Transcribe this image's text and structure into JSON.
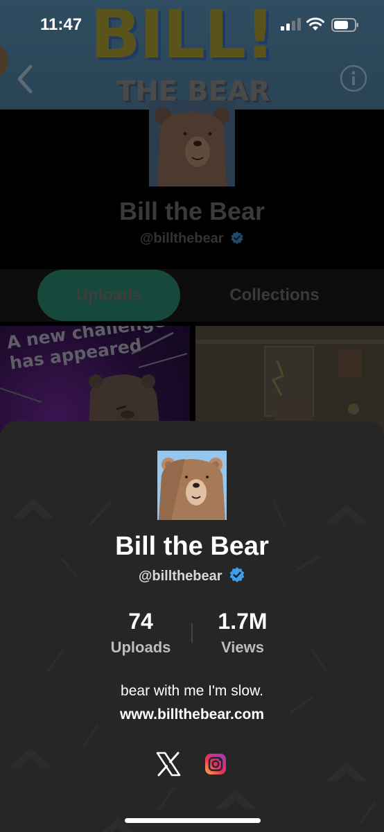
{
  "status_bar": {
    "time": "11:47"
  },
  "banner": {
    "title": "BILL!",
    "subtitle": "THE BEAR"
  },
  "profile": {
    "name": "Bill the Bear",
    "handle": "@billthebear",
    "verified": true
  },
  "tabs": [
    {
      "label": "Uploads",
      "active": true
    },
    {
      "label": "Collections",
      "active": false
    }
  ],
  "thumbnails": [
    {
      "caption": "A new challehger\nhas appeared"
    },
    {
      "caption": ""
    }
  ],
  "sheet": {
    "name": "Bill the Bear",
    "handle": "@billthebear",
    "stats": {
      "uploads_value": "74",
      "uploads_label": "Uploads",
      "views_value": "1.7M",
      "views_label": "Views"
    },
    "bio": "bear with me I'm slow.",
    "website": "www.billthebear.com",
    "socials": [
      "x-icon",
      "instagram-icon"
    ]
  },
  "colors": {
    "accent_green": "#16483b",
    "verified_blue": "#3d9ef0",
    "sheet_bg": "#262626",
    "avatar_bg": "#96c6ec"
  }
}
